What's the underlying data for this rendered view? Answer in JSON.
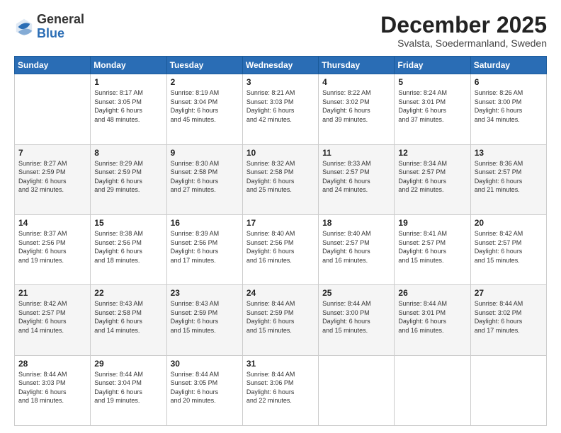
{
  "header": {
    "logo_general": "General",
    "logo_blue": "Blue",
    "month_title": "December 2025",
    "location": "Svalsta, Soedermanland, Sweden"
  },
  "days_of_week": [
    "Sunday",
    "Monday",
    "Tuesday",
    "Wednesday",
    "Thursday",
    "Friday",
    "Saturday"
  ],
  "weeks": [
    [
      {
        "day": "",
        "info": ""
      },
      {
        "day": "1",
        "info": "Sunrise: 8:17 AM\nSunset: 3:05 PM\nDaylight: 6 hours\nand 48 minutes."
      },
      {
        "day": "2",
        "info": "Sunrise: 8:19 AM\nSunset: 3:04 PM\nDaylight: 6 hours\nand 45 minutes."
      },
      {
        "day": "3",
        "info": "Sunrise: 8:21 AM\nSunset: 3:03 PM\nDaylight: 6 hours\nand 42 minutes."
      },
      {
        "day": "4",
        "info": "Sunrise: 8:22 AM\nSunset: 3:02 PM\nDaylight: 6 hours\nand 39 minutes."
      },
      {
        "day": "5",
        "info": "Sunrise: 8:24 AM\nSunset: 3:01 PM\nDaylight: 6 hours\nand 37 minutes."
      },
      {
        "day": "6",
        "info": "Sunrise: 8:26 AM\nSunset: 3:00 PM\nDaylight: 6 hours\nand 34 minutes."
      }
    ],
    [
      {
        "day": "7",
        "info": "Sunrise: 8:27 AM\nSunset: 2:59 PM\nDaylight: 6 hours\nand 32 minutes."
      },
      {
        "day": "8",
        "info": "Sunrise: 8:29 AM\nSunset: 2:59 PM\nDaylight: 6 hours\nand 29 minutes."
      },
      {
        "day": "9",
        "info": "Sunrise: 8:30 AM\nSunset: 2:58 PM\nDaylight: 6 hours\nand 27 minutes."
      },
      {
        "day": "10",
        "info": "Sunrise: 8:32 AM\nSunset: 2:58 PM\nDaylight: 6 hours\nand 25 minutes."
      },
      {
        "day": "11",
        "info": "Sunrise: 8:33 AM\nSunset: 2:57 PM\nDaylight: 6 hours\nand 24 minutes."
      },
      {
        "day": "12",
        "info": "Sunrise: 8:34 AM\nSunset: 2:57 PM\nDaylight: 6 hours\nand 22 minutes."
      },
      {
        "day": "13",
        "info": "Sunrise: 8:36 AM\nSunset: 2:57 PM\nDaylight: 6 hours\nand 21 minutes."
      }
    ],
    [
      {
        "day": "14",
        "info": "Sunrise: 8:37 AM\nSunset: 2:56 PM\nDaylight: 6 hours\nand 19 minutes."
      },
      {
        "day": "15",
        "info": "Sunrise: 8:38 AM\nSunset: 2:56 PM\nDaylight: 6 hours\nand 18 minutes."
      },
      {
        "day": "16",
        "info": "Sunrise: 8:39 AM\nSunset: 2:56 PM\nDaylight: 6 hours\nand 17 minutes."
      },
      {
        "day": "17",
        "info": "Sunrise: 8:40 AM\nSunset: 2:56 PM\nDaylight: 6 hours\nand 16 minutes."
      },
      {
        "day": "18",
        "info": "Sunrise: 8:40 AM\nSunset: 2:57 PM\nDaylight: 6 hours\nand 16 minutes."
      },
      {
        "day": "19",
        "info": "Sunrise: 8:41 AM\nSunset: 2:57 PM\nDaylight: 6 hours\nand 15 minutes."
      },
      {
        "day": "20",
        "info": "Sunrise: 8:42 AM\nSunset: 2:57 PM\nDaylight: 6 hours\nand 15 minutes."
      }
    ],
    [
      {
        "day": "21",
        "info": "Sunrise: 8:42 AM\nSunset: 2:57 PM\nDaylight: 6 hours\nand 14 minutes."
      },
      {
        "day": "22",
        "info": "Sunrise: 8:43 AM\nSunset: 2:58 PM\nDaylight: 6 hours\nand 14 minutes."
      },
      {
        "day": "23",
        "info": "Sunrise: 8:43 AM\nSunset: 2:59 PM\nDaylight: 6 hours\nand 15 minutes."
      },
      {
        "day": "24",
        "info": "Sunrise: 8:44 AM\nSunset: 2:59 PM\nDaylight: 6 hours\nand 15 minutes."
      },
      {
        "day": "25",
        "info": "Sunrise: 8:44 AM\nSunset: 3:00 PM\nDaylight: 6 hours\nand 15 minutes."
      },
      {
        "day": "26",
        "info": "Sunrise: 8:44 AM\nSunset: 3:01 PM\nDaylight: 6 hours\nand 16 minutes."
      },
      {
        "day": "27",
        "info": "Sunrise: 8:44 AM\nSunset: 3:02 PM\nDaylight: 6 hours\nand 17 minutes."
      }
    ],
    [
      {
        "day": "28",
        "info": "Sunrise: 8:44 AM\nSunset: 3:03 PM\nDaylight: 6 hours\nand 18 minutes."
      },
      {
        "day": "29",
        "info": "Sunrise: 8:44 AM\nSunset: 3:04 PM\nDaylight: 6 hours\nand 19 minutes."
      },
      {
        "day": "30",
        "info": "Sunrise: 8:44 AM\nSunset: 3:05 PM\nDaylight: 6 hours\nand 20 minutes."
      },
      {
        "day": "31",
        "info": "Sunrise: 8:44 AM\nSunset: 3:06 PM\nDaylight: 6 hours\nand 22 minutes."
      },
      {
        "day": "",
        "info": ""
      },
      {
        "day": "",
        "info": ""
      },
      {
        "day": "",
        "info": ""
      }
    ]
  ]
}
